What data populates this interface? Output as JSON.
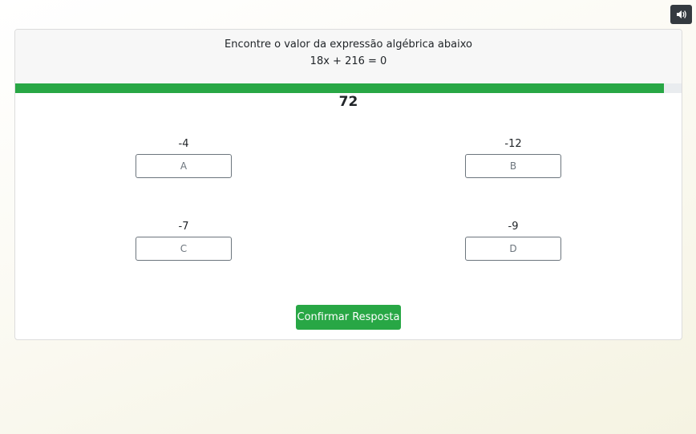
{
  "sound_button": {
    "icon": "speaker-volume-icon"
  },
  "question": {
    "title": "Encontre o valor da expressão algébrica abaixo",
    "expression": "18x + 216 = 0"
  },
  "progress": {
    "fraction": 0.974,
    "color": "#28a745"
  },
  "timer": "72",
  "options": [
    {
      "value": "-4",
      "label": "A"
    },
    {
      "value": "-12",
      "label": "B"
    },
    {
      "value": "-7",
      "label": "C"
    },
    {
      "value": "-9",
      "label": "D"
    }
  ],
  "confirm_label": "Confirmar Resposta",
  "colors": {
    "accent": "#28a745",
    "dark_button": "#343a40"
  }
}
